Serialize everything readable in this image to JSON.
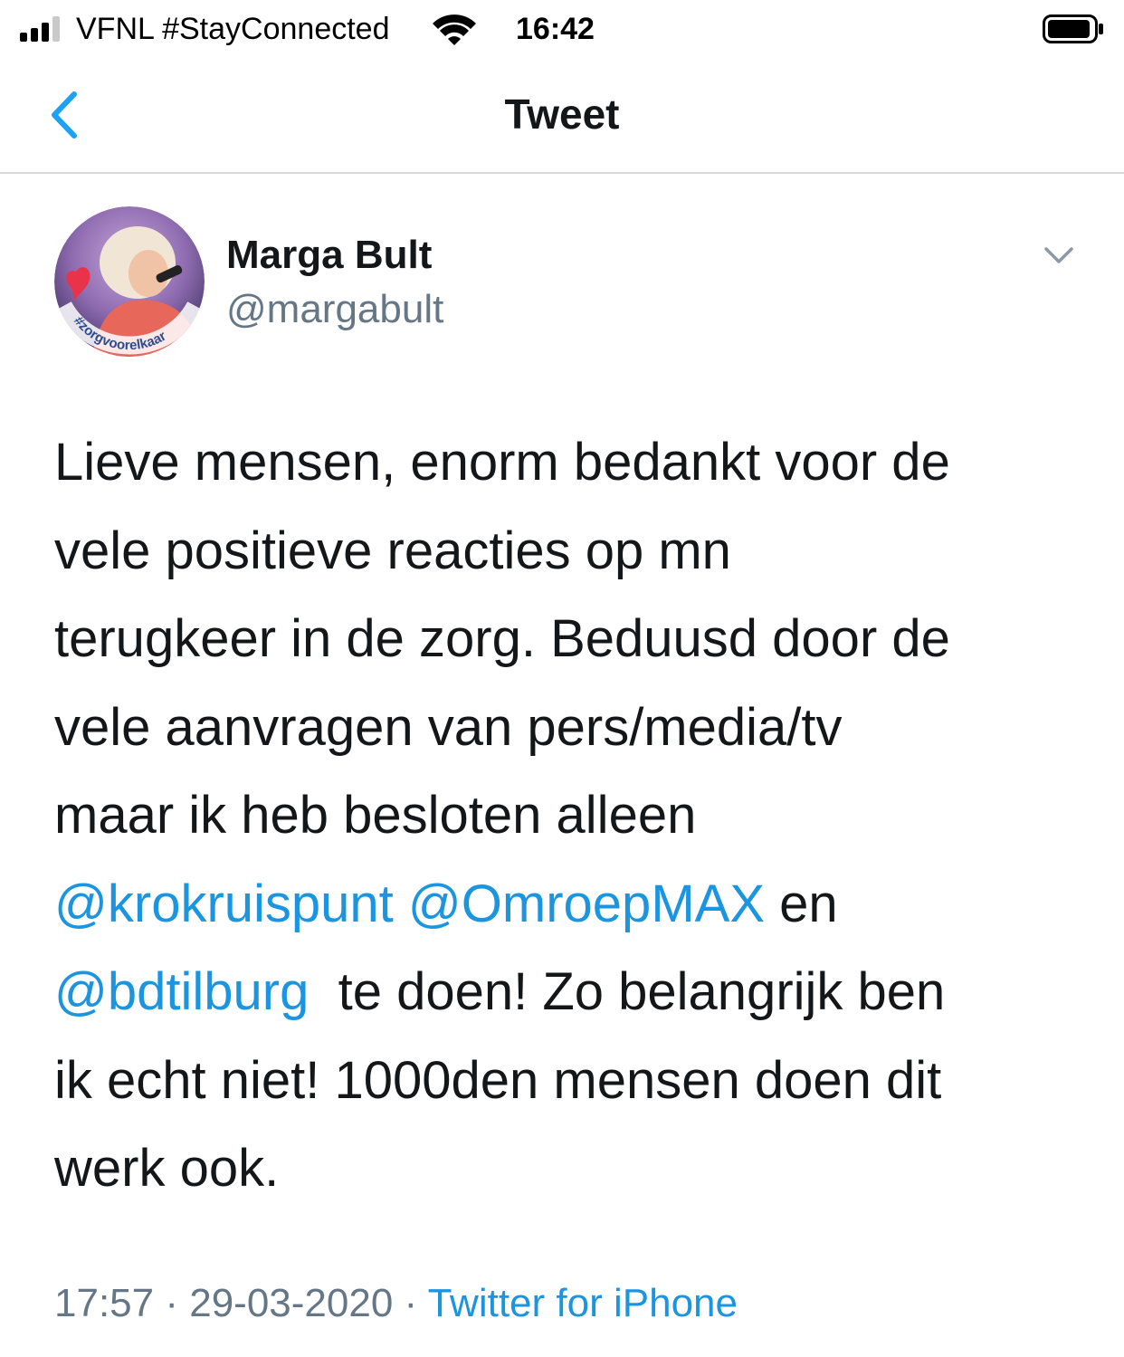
{
  "status_bar": {
    "carrier": "VFNL #StayConnected",
    "time": "16:42",
    "signal_bars_filled": 3,
    "signal_bars_total": 4
  },
  "nav": {
    "title": "Tweet",
    "back_icon": "chevron-left-icon"
  },
  "tweet": {
    "author_name": "Marga Bult",
    "author_handle": "@margabult",
    "avatar_badge_text": "#zorgvoorelkaar",
    "more_icon": "chevron-down-icon",
    "lines": [
      [
        {
          "t": "Lieve mensen, enorm bedankt voor de"
        }
      ],
      [
        {
          "t": "vele positieve reacties op mn"
        }
      ],
      [
        {
          "t": "terugkeer in de zorg. Beduusd door de"
        }
      ],
      [
        {
          "t": "vele aanvragen van pers/media/tv"
        }
      ],
      [
        {
          "t": "maar ik heb besloten alleen"
        }
      ],
      [
        {
          "t": "@krokruispunt",
          "m": true
        },
        {
          "t": " "
        },
        {
          "t": "@OmroepMAX",
          "m": true
        },
        {
          "t": " en"
        }
      ],
      [
        {
          "t": "@bdtilburg",
          "m": true
        },
        {
          "t": "  te doen! Zo belangrijk ben"
        }
      ],
      [
        {
          "t": "ik echt niet! 1000den mensen doen dit"
        }
      ],
      [
        {
          "t": "werk ook."
        }
      ]
    ],
    "time": "17:57",
    "separator": " · ",
    "date": "29-03-2020",
    "source": "Twitter for iPhone"
  },
  "colors": {
    "link": "#1b95e0",
    "text": "#14171a",
    "secondary": "#657786",
    "back_arrow": "#1da1f2"
  }
}
